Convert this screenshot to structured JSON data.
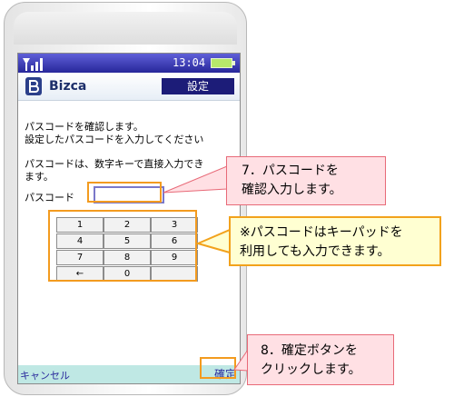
{
  "status_bar": {
    "time": "13:04"
  },
  "app": {
    "name": "Bizca",
    "screen_title": "設定"
  },
  "instructions": {
    "line1": "パスコードを確認します。",
    "line2": "設定したパスコードを入力してください",
    "line3": "パスコードは、数字キーで直接入力でき",
    "line4": "ます。"
  },
  "passcode": {
    "label": "パスコード",
    "value": ""
  },
  "keypad": {
    "keys": [
      "1",
      "2",
      "3",
      "4",
      "5",
      "6",
      "7",
      "8",
      "9",
      "←",
      "0",
      ""
    ]
  },
  "softkeys": {
    "left": "キャンセル",
    "right": "確定"
  },
  "callouts": {
    "step7": {
      "line1": "7．パスコードを",
      "line2": "確認入力します。"
    },
    "note": {
      "line1": "※パスコードはキーパッドを",
      "line2": "利用しても入力できます。"
    },
    "step8": {
      "line1": "8．確定ボタンを",
      "line2": "クリックします。"
    }
  },
  "colors": {
    "status_bar": "#27279a",
    "title_box": "#1c1c78",
    "softbar": "#bfe8e4",
    "highlight": "#f39b1f",
    "callout_pink": "#ffe0e4",
    "callout_yellow": "#ffffd2"
  }
}
